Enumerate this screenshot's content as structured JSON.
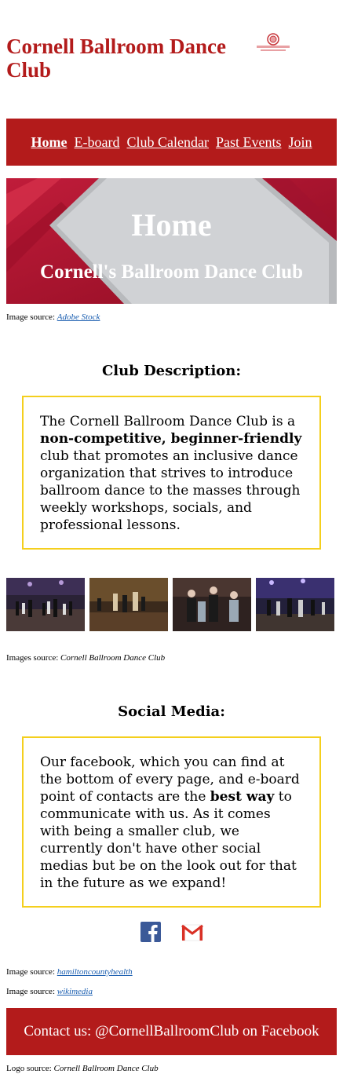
{
  "site": {
    "title": "Cornell Ballroom Dance Club",
    "brand_color": "#b31b1b",
    "accent_border": "#f4cf1d"
  },
  "nav": {
    "items": [
      {
        "label": "Home",
        "active": true
      },
      {
        "label": "E-board",
        "active": false
      },
      {
        "label": "Club Calendar",
        "active": false
      },
      {
        "label": "Past Events",
        "active": false
      },
      {
        "label": "Join",
        "active": false
      }
    ]
  },
  "hero": {
    "title": "Home",
    "subtitle": "Cornell's Ballroom Dance Club",
    "caption_prefix": "Image source: ",
    "caption_link": "Adobe Stock"
  },
  "description": {
    "heading": "Club Description:",
    "text_before": "The Cornell Ballroom Dance Club is a ",
    "bold": "non-competitive, beginner-friendly",
    "text_after": " club that promotes an inclusive dance organization that strives to introduce ballroom dance to the masses through weekly workshops, socials, and professional lessons."
  },
  "gallery": {
    "caption_prefix": "Images source: ",
    "caption_source": "Cornell Ballroom Dance Club"
  },
  "social": {
    "heading": "Social Media:",
    "text_before": "Our facebook, which you can find at the bottom of every page, and e-board point of contacts are the ",
    "bold": "best way",
    "text_after": " to communicate with us. As it comes with being a smaller club, we currently don't have other social medias but be on the look out for that in the future as we expand!",
    "icons": [
      "facebook-icon",
      "gmail-icon"
    ],
    "caption1_prefix": "Image source: ",
    "caption1_link": "hamiltoncountyhealth",
    "caption2_prefix": "Image source: ",
    "caption2_link": "wikimedia"
  },
  "footer": {
    "contact": "Contact us: @CornellBallroomClub on Facebook",
    "logo_caption_prefix": "Logo source: ",
    "logo_caption_source": "Cornell Ballroom Dance Club"
  }
}
